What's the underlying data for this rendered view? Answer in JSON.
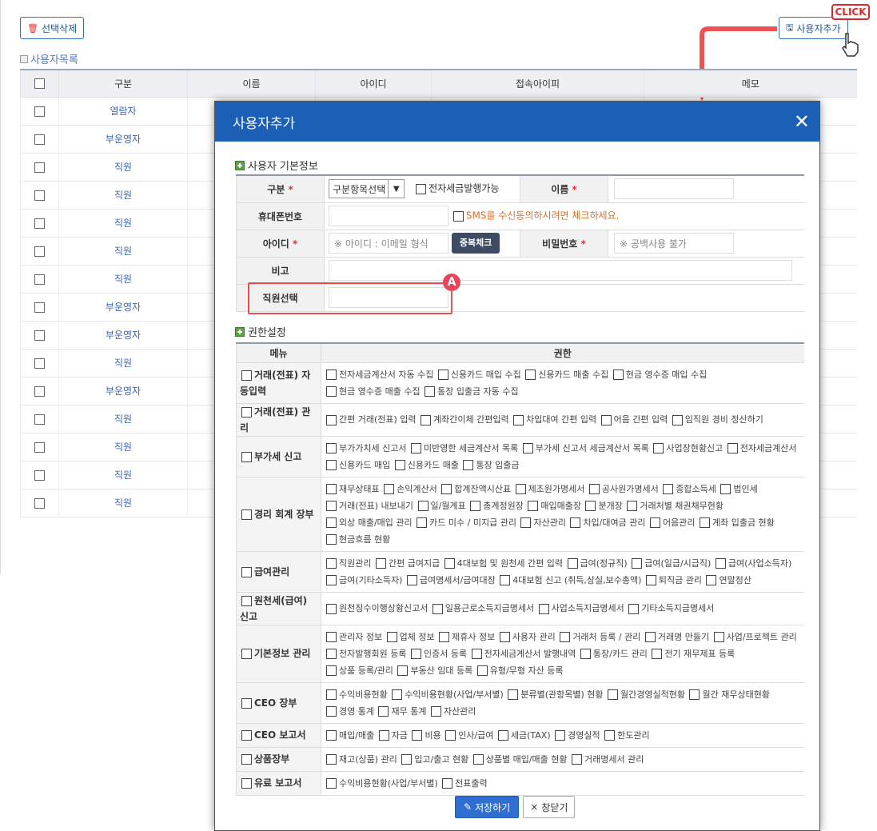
{
  "toolbar": {
    "delete_label": "선택삭제",
    "add_label": "사용자추가",
    "click_tag": "CLICK"
  },
  "list": {
    "title": "사용자목록",
    "headers": [
      "구분",
      "이름",
      "아이디",
      "접속아이피",
      "메모"
    ],
    "rows": [
      "열람자",
      "부운영자",
      "직원",
      "직원",
      "직원",
      "직원",
      "직원",
      "부운영자",
      "부운영자",
      "직원",
      "부운영자",
      "직원",
      "직원",
      "직원",
      "직원"
    ]
  },
  "modal": {
    "title": "사용자추가",
    "close": "✕",
    "basic_title": "사용자 기본정보",
    "fields": {
      "category_label": "구분",
      "category_value": "구분항목선택",
      "tax_invoice_label": "전자세금발행가능",
      "name_label": "이름",
      "phone_label": "휴대폰번호",
      "sms_label": "SMS를 수신동의하시려면 체크하세요.",
      "id_label": "아이디",
      "id_placeholder": "※ 아이디 : 이메일 형식",
      "dup_check": "중복체크",
      "password_label": "비밀번호",
      "password_placeholder": "※ 공백사용 불가",
      "note_label": "비고",
      "staff_label": "직원선택",
      "required_mark": "*"
    },
    "badge": "A",
    "perm_title": "권한설정",
    "perm_headers": {
      "menu": "메뉴",
      "perm": "권한"
    },
    "perms": [
      {
        "menu": "거래(전표) 자동입력",
        "items": [
          "전자세금계산서 자동 수집",
          "신용카드 매입 수집",
          "신용카드 매출 수집",
          "현금 영수증 매입 수집",
          "현금 영수증 매출 수집",
          "통장 입출금 자동 수집"
        ]
      },
      {
        "menu": "거래(전표) 관리",
        "items": [
          "간편 거래(전표) 입력",
          "계좌간이체 간편입력",
          "차입대여 간편 입력",
          "어음 간편 입력",
          "임직원 경비 정산하기"
        ]
      },
      {
        "menu": "부가세 신고",
        "items": [
          "부가가치세 신고서",
          "미반영한 세금계산서 목록",
          "부가세 신고서 세금계산서 목록",
          "사업장현황신고",
          "전자세금계산서",
          "신용카드 매입",
          "신용카드 매출",
          "통장 입출금"
        ]
      },
      {
        "menu": "경리 회계 장부",
        "items": [
          "재무상태표",
          "손익계산서",
          "합계잔액시산표",
          "제조원가명세서",
          "공사원가명세서",
          "종합소득세",
          "법인세",
          "거래(전표) 내보내기",
          "일/월계표",
          "총계정원장",
          "매입매출장",
          "분개장",
          "거래처별 채권채무현황",
          "외상 매출/매입 관리",
          "카드 미수 / 미지급 관리",
          "자산관리",
          "차입/대여금 관리",
          "어음관리",
          "계좌 입출금 현황",
          "현금흐름 현황"
        ]
      },
      {
        "menu": "급여관리",
        "items": [
          "직원관리",
          "간편 급여지급",
          "4대보험 및 원천세 간편 입력",
          "급여(정규직)",
          "급여(일급/시급직)",
          "급여(사업소득자)",
          "급여(기타소득자)",
          "급여명세서/급여대장",
          "4대보험 신고 (취득,상실,보수총액)",
          "퇴직금 관리",
          "연말정산"
        ]
      },
      {
        "menu": "원천세(급여) 신고",
        "items": [
          "원천징수이행상황신고서",
          "일용근로소득지급명세서",
          "사업소득지급명세서",
          "기타소득지급명세서"
        ]
      },
      {
        "menu": "기본정보 관리",
        "items": [
          "관리자 정보",
          "업체 정보",
          "제휴사 정보",
          "사용자 관리",
          "거래처 등록 / 관리",
          "거래명 만들기",
          "사업/프로젝트 관리",
          "전자발행회원 등록",
          "인증서 등록",
          "전자세금계산서 발행내역",
          "통장/카드 관리",
          "전기 재무제표 등록",
          "상품 등록/관리",
          "부동산 임대 등록",
          "유형/무형 자산 등록"
        ]
      },
      {
        "menu": "CEO 장부",
        "items": [
          "수익비용현황",
          "수익비용현황(사업/부서별)",
          "분류별(관항목별) 현황",
          "월간경영실적현황",
          "월간 재무상태현황",
          "경영 통계",
          "재무 통계",
          "자산관리"
        ]
      },
      {
        "menu": "CEO 보고서",
        "items": [
          "매입/매출",
          "자금",
          "비용",
          "인사/급여",
          "세금(TAX)",
          "경영실적",
          "한도관리"
        ]
      },
      {
        "menu": "상품장부",
        "items": [
          "재고(상품) 관리",
          "입고/출고 현황",
          "상품별 매입/매출 현황",
          "거래명세서 관리"
        ]
      },
      {
        "menu": "유료 보고서",
        "items": [
          "수익비용현황(사업/부서별)",
          "전표출력"
        ]
      }
    ],
    "save_label": "저장하기",
    "close_label": "창닫기"
  }
}
